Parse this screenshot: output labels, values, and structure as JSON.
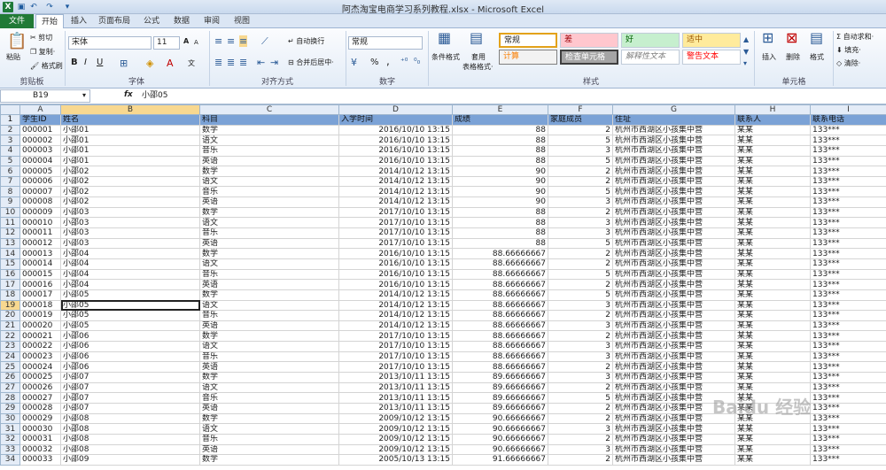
{
  "window": {
    "title": "阿杰淘宝电商学习系列教程.xlsx - Microsoft Excel"
  },
  "quick_access": {
    "app_icon": "X",
    "save_icon": "save-icon",
    "undo_icon": "undo-icon",
    "redo_icon": "redo-icon"
  },
  "tabs": {
    "file": "文件",
    "home": "开始",
    "insert": "插入",
    "layout": "页面布局",
    "formulas": "公式",
    "data": "数据",
    "review": "审阅",
    "view": "视图"
  },
  "ribbon": {
    "clipboard": {
      "paste": "粘贴",
      "cut": "剪切",
      "copy": "复制·",
      "format_painter": "格式刷",
      "label": "剪贴板"
    },
    "font": {
      "name": "宋体",
      "size": "11",
      "grow": "A",
      "shrink": "A",
      "bold": "B",
      "italic": "I",
      "underline": "U",
      "phonetic": "文",
      "label": "字体"
    },
    "alignment": {
      "wrap": "自动换行",
      "merge": "合并后居中·",
      "label": "对齐方式"
    },
    "number": {
      "format": "常规",
      "percent": "%",
      "comma": ",",
      "label": "数字"
    },
    "styles": {
      "cond_format": "条件格式",
      "table_format": "套用",
      "table_format2": "表格格式·",
      "normal": "常规",
      "bad": "差",
      "good": "好",
      "neutral": "适中",
      "calc": "计算",
      "check": "检查单元格",
      "explanatory": "解释性文本",
      "warning": "警告文本",
      "label": "样式"
    },
    "cells": {
      "insert": "插入",
      "delete": "删除",
      "format": "格式",
      "label": "单元格"
    },
    "editing": {
      "autosum": "自动求和·",
      "fill": "填充·",
      "clear": "清除·"
    }
  },
  "formula_bar": {
    "name_box": "B19",
    "fx": "fx",
    "content": "小邵05"
  },
  "columns": [
    "A",
    "B",
    "C",
    "D",
    "E",
    "F",
    "G",
    "H",
    "I"
  ],
  "headers": [
    "学生ID",
    "姓名",
    "科目",
    "入学时间",
    "成绩",
    "家庭成员",
    "住址",
    "联系人",
    "联系电话"
  ],
  "rows": [
    [
      "000001",
      "小邵01",
      "数学",
      "2016/10/10 13:15",
      "88",
      "2",
      "杭州市西湖区小孩集中营",
      "某某",
      "133***"
    ],
    [
      "000002",
      "小邵01",
      "语文",
      "2016/10/10 13:15",
      "88",
      "5",
      "杭州市西湖区小孩集中营",
      "某某",
      "133***"
    ],
    [
      "000003",
      "小邵01",
      "音乐",
      "2016/10/10 13:15",
      "88",
      "3",
      "杭州市西湖区小孩集中营",
      "某某",
      "133***"
    ],
    [
      "000004",
      "小邵01",
      "英语",
      "2016/10/10 13:15",
      "88",
      "5",
      "杭州市西湖区小孩集中营",
      "某某",
      "133***"
    ],
    [
      "000005",
      "小邵02",
      "数学",
      "2014/10/12 13:15",
      "90",
      "2",
      "杭州市西湖区小孩集中营",
      "某某",
      "133***"
    ],
    [
      "000006",
      "小邵02",
      "语文",
      "2014/10/12 13:15",
      "90",
      "2",
      "杭州市西湖区小孩集中营",
      "某某",
      "133***"
    ],
    [
      "000007",
      "小邵02",
      "音乐",
      "2014/10/12 13:15",
      "90",
      "5",
      "杭州市西湖区小孩集中营",
      "某某",
      "133***"
    ],
    [
      "000008",
      "小邵02",
      "英语",
      "2014/10/12 13:15",
      "90",
      "3",
      "杭州市西湖区小孩集中营",
      "某某",
      "133***"
    ],
    [
      "000009",
      "小邵03",
      "数学",
      "2017/10/10 13:15",
      "88",
      "2",
      "杭州市西湖区小孩集中营",
      "某某",
      "133***"
    ],
    [
      "000010",
      "小邵03",
      "语文",
      "2017/10/10 13:15",
      "88",
      "3",
      "杭州市西湖区小孩集中营",
      "某某",
      "133***"
    ],
    [
      "000011",
      "小邵03",
      "音乐",
      "2017/10/10 13:15",
      "88",
      "3",
      "杭州市西湖区小孩集中营",
      "某某",
      "133***"
    ],
    [
      "000012",
      "小邵03",
      "英语",
      "2017/10/10 13:15",
      "88",
      "5",
      "杭州市西湖区小孩集中营",
      "某某",
      "133***"
    ],
    [
      "000013",
      "小邵04",
      "数学",
      "2016/10/10 13:15",
      "88.66666667",
      "2",
      "杭州市西湖区小孩集中营",
      "某某",
      "133***"
    ],
    [
      "000014",
      "小邵04",
      "语文",
      "2016/10/10 13:15",
      "88.66666667",
      "2",
      "杭州市西湖区小孩集中营",
      "某某",
      "133***"
    ],
    [
      "000015",
      "小邵04",
      "音乐",
      "2016/10/10 13:15",
      "88.66666667",
      "5",
      "杭州市西湖区小孩集中营",
      "某某",
      "133***"
    ],
    [
      "000016",
      "小邵04",
      "英语",
      "2016/10/10 13:15",
      "88.66666667",
      "2",
      "杭州市西湖区小孩集中营",
      "某某",
      "133***"
    ],
    [
      "000017",
      "小邵05",
      "数学",
      "2014/10/12 13:15",
      "88.66666667",
      "5",
      "杭州市西湖区小孩集中营",
      "某某",
      "133***"
    ],
    [
      "000018",
      "小邵05",
      "语文",
      "2014/10/12 13:15",
      "88.66666667",
      "3",
      "杭州市西湖区小孩集中营",
      "某某",
      "133***"
    ],
    [
      "000019",
      "小邵05",
      "音乐",
      "2014/10/12 13:15",
      "88.66666667",
      "2",
      "杭州市西湖区小孩集中营",
      "某某",
      "133***"
    ],
    [
      "000020",
      "小邵05",
      "英语",
      "2014/10/12 13:15",
      "88.66666667",
      "3",
      "杭州市西湖区小孩集中营",
      "某某",
      "133***"
    ],
    [
      "000021",
      "小邵06",
      "数学",
      "2017/10/10 13:15",
      "88.66666667",
      "2",
      "杭州市西湖区小孩集中营",
      "某某",
      "133***"
    ],
    [
      "000022",
      "小邵06",
      "语文",
      "2017/10/10 13:15",
      "88.66666667",
      "3",
      "杭州市西湖区小孩集中营",
      "某某",
      "133***"
    ],
    [
      "000023",
      "小邵06",
      "音乐",
      "2017/10/10 13:15",
      "88.66666667",
      "3",
      "杭州市西湖区小孩集中营",
      "某某",
      "133***"
    ],
    [
      "000024",
      "小邵06",
      "英语",
      "2017/10/10 13:15",
      "88.66666667",
      "2",
      "杭州市西湖区小孩集中营",
      "某某",
      "133***"
    ],
    [
      "000025",
      "小邵07",
      "数学",
      "2013/10/11 13:15",
      "89.66666667",
      "3",
      "杭州市西湖区小孩集中营",
      "某某",
      "133***"
    ],
    [
      "000026",
      "小邵07",
      "语文",
      "2013/10/11 13:15",
      "89.66666667",
      "2",
      "杭州市西湖区小孩集中营",
      "某某",
      "133***"
    ],
    [
      "000027",
      "小邵07",
      "音乐",
      "2013/10/11 13:15",
      "89.66666667",
      "5",
      "杭州市西湖区小孩集中营",
      "某某",
      "133***"
    ],
    [
      "000028",
      "小邵07",
      "英语",
      "2013/10/11 13:15",
      "89.66666667",
      "2",
      "杭州市西湖区小孩集中营",
      "某某",
      "133***"
    ],
    [
      "000029",
      "小邵08",
      "数学",
      "2009/10/12 13:15",
      "90.66666667",
      "2",
      "杭州市西湖区小孩集中营",
      "某某",
      "133***"
    ],
    [
      "000030",
      "小邵08",
      "语文",
      "2009/10/12 13:15",
      "90.66666667",
      "3",
      "杭州市西湖区小孩集中营",
      "某某",
      "133***"
    ],
    [
      "000031",
      "小邵08",
      "音乐",
      "2009/10/12 13:15",
      "90.66666667",
      "2",
      "杭州市西湖区小孩集中营",
      "某某",
      "133***"
    ],
    [
      "000032",
      "小邵08",
      "英语",
      "2009/10/12 13:15",
      "90.66666667",
      "3",
      "杭州市西湖区小孩集中营",
      "某某",
      "133***"
    ],
    [
      "000033",
      "小邵09",
      "数学",
      "2005/10/13 13:15",
      "91.66666667",
      "2",
      "杭州市西湖区小孩集中营",
      "某某",
      "133***"
    ]
  ],
  "selection": {
    "active_cell": "B19"
  },
  "watermark": "Baidu 经验"
}
